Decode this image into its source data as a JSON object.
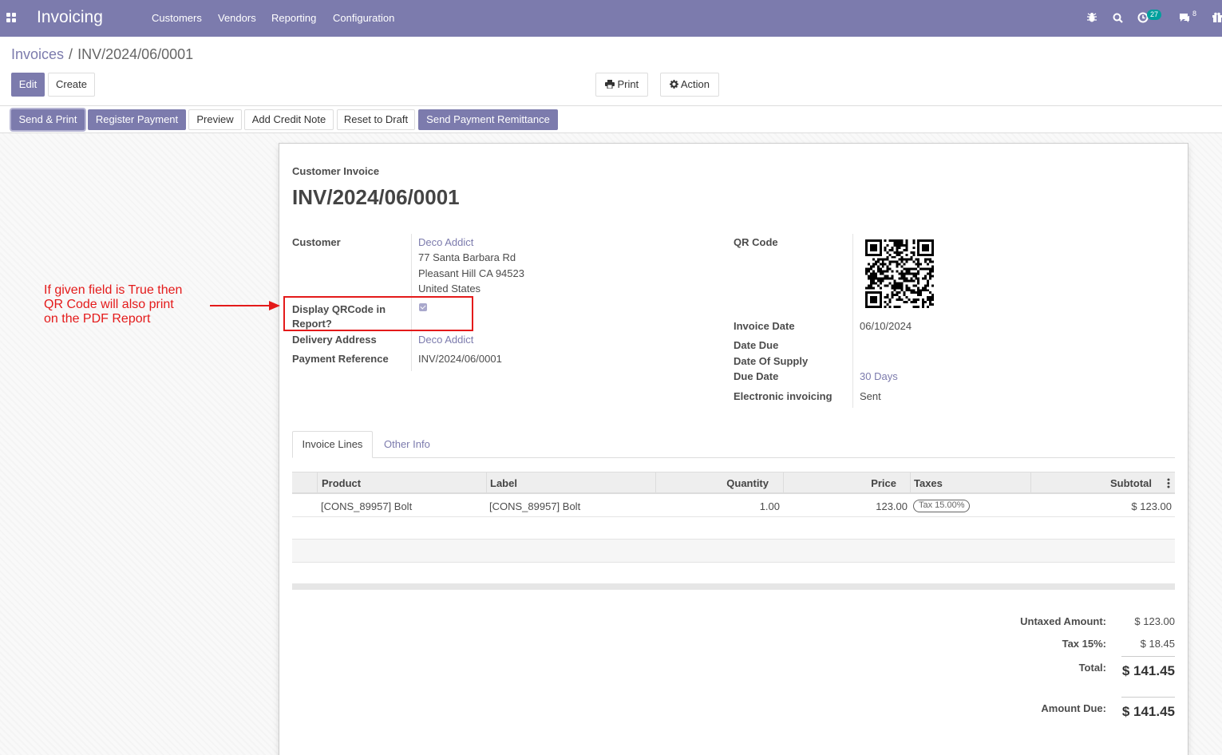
{
  "navbar": {
    "app_name": "Invoicing",
    "menu": [
      "Customers",
      "Vendors",
      "Reporting",
      "Configuration"
    ],
    "activity_count": "27",
    "message_count": "8"
  },
  "breadcrumb": {
    "parent": "Invoices",
    "separator": "/",
    "current": "INV/2024/06/0001"
  },
  "control": {
    "edit": "Edit",
    "create": "Create",
    "print": "Print",
    "action": "Action"
  },
  "statusbar": {
    "send_print": "Send & Print",
    "register_payment": "Register Payment",
    "preview": "Preview",
    "add_credit_note": "Add Credit Note",
    "reset_to_draft": "Reset to Draft",
    "send_payment_remittance": "Send Payment Remittance"
  },
  "invoice": {
    "type": "Customer Invoice",
    "number": "INV/2024/06/0001",
    "customer_label": "Customer",
    "customer_name": "Deco Addict",
    "address": [
      "77 Santa Barbara Rd",
      "Pleasant Hill CA 94523",
      "United States"
    ],
    "display_qr_label_1": "Display QRCode in",
    "display_qr_label_2": "Report?",
    "display_qr_checked": true,
    "delivery_label": "Delivery Address",
    "delivery_value": "Deco Addict",
    "payref_label": "Payment Reference",
    "payref_value": "INV/2024/06/0001",
    "qr_label": "QR Code",
    "invoice_date_label": "Invoice Date",
    "invoice_date_value": "06/10/2024",
    "date_due_label": "Date Due",
    "date_supply_label": "Date Of Supply",
    "due_date_label": "Due Date",
    "due_date_value": "30 Days",
    "einvoice_label": "Electronic invoicing",
    "einvoice_value": "Sent"
  },
  "tabs": {
    "lines": "Invoice Lines",
    "other": "Other Info"
  },
  "table": {
    "headers": {
      "product": "Product",
      "label": "Label",
      "quantity": "Quantity",
      "price": "Price",
      "taxes": "Taxes",
      "subtotal": "Subtotal"
    },
    "rows": [
      {
        "product": "[CONS_89957] Bolt",
        "label": "[CONS_89957] Bolt",
        "quantity": "1.00",
        "price": "123.00",
        "tax": "Tax 15.00%",
        "subtotal": "$ 123.00"
      }
    ]
  },
  "totals": {
    "untaxed_label": "Untaxed Amount:",
    "untaxed_value": "$ 123.00",
    "tax_label": "Tax 15%:",
    "tax_value": "$ 18.45",
    "total_label": "Total:",
    "total_value": "$ 141.45",
    "amount_due_label": "Amount Due:",
    "amount_due_value": "$ 141.45"
  },
  "annotation": {
    "lines": [
      "If given field is True then",
      "QR Code will also print",
      "on the PDF Report"
    ],
    "color": "#e41a1a"
  },
  "colors": {
    "brand": "#7c7bad",
    "badge": "#00a09d"
  }
}
